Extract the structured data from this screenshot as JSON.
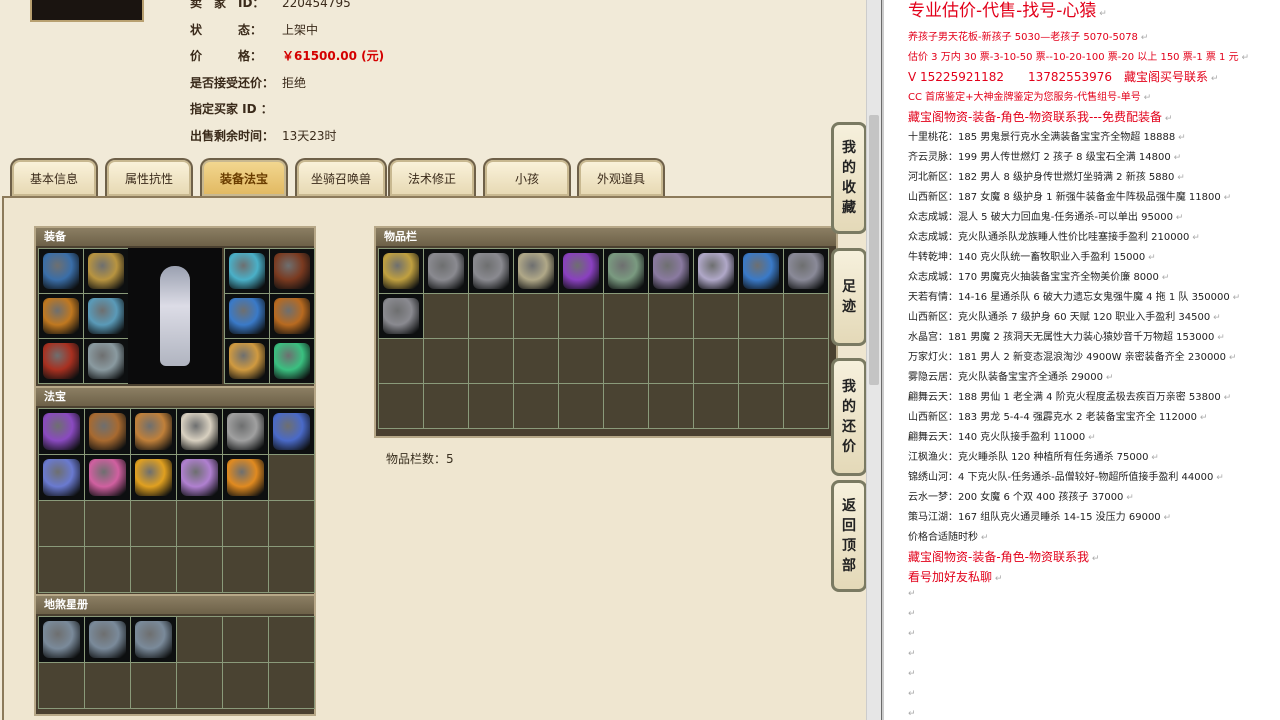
{
  "profile": {
    "rows": [
      {
        "label": "卖　家　ID：",
        "value": "220454795",
        "style": "normal"
      },
      {
        "label": "状　　　态：",
        "value": "上架中",
        "style": "normal"
      },
      {
        "label": "价　　　格：",
        "value": "￥61500.00 (元)",
        "style": "price"
      },
      {
        "label": "是否接受还价：",
        "value": "拒绝",
        "style": "normal"
      },
      {
        "label": "指定买家 ID ：",
        "value": "",
        "style": "normal"
      },
      {
        "label": "出售剩余时间：",
        "value": "13天23时",
        "style": "normal"
      }
    ]
  },
  "tabs": [
    "基本信息",
    "属性抗性",
    "装备法宝",
    "坐骑召唤兽",
    "法术修正",
    "小孩",
    "外观道具"
  ],
  "active_tab": "装备法宝",
  "sections": {
    "equip": "装备",
    "treasure": "法宝",
    "stars": "地煞星册",
    "inventory": "物品栏"
  },
  "inventory_count": "物品栏数：5",
  "side_buttons": [
    {
      "name": "my-collection",
      "chars": [
        "我",
        "的",
        "收",
        "藏"
      ]
    },
    {
      "name": "footprint",
      "chars": [
        "足",
        "迹"
      ]
    },
    {
      "name": "my-bargain",
      "chars": [
        "我",
        "的",
        "还",
        "价"
      ]
    },
    {
      "name": "back-to-top",
      "chars": [
        "返",
        "回",
        "顶",
        "部"
      ]
    }
  ],
  "notes": [
    {
      "text": "专业估价-代售-找号-心猿",
      "style": "big red"
    },
    {
      "text": "养孩子男天花板-新孩子 5030—老孩子 5070-5078",
      "style": "red"
    },
    {
      "text": "估价 3 万内 30 票-3-10-50 票--10-20-100 票-20 以上 150 票-1 票 1 元",
      "style": "red"
    },
    {
      "text": "V 15225921182　　13782553976　藏宝阁买号联系",
      "style": "med red"
    },
    {
      "text": "CC 首席鉴定+大神金牌鉴定为您服务-代售组号-单号",
      "style": "red"
    },
    {
      "text": "藏宝阁物资-装备-角色-物资联系我---免费配装备",
      "style": "med red"
    },
    {
      "text": "十里桃花：185 男鬼景行克水全满装备宝宝齐全物超 18888",
      "style": ""
    },
    {
      "text": "齐云灵脉：199 男人传世燃灯 2 孩子 8 级宝石全满 14800",
      "style": ""
    },
    {
      "text": "河北新区：182 男人 8 级护身传世燃灯坐骑满 2 新孩 5880",
      "style": ""
    },
    {
      "text": "山西新区：187 女魔 8 级护身 1 新强牛装备金牛阵极品强牛魔 11800",
      "style": ""
    },
    {
      "text": "众志成城：混人 5 破大力回血鬼-任务通杀-可以单出 95000",
      "style": ""
    },
    {
      "text": "众志成城：克火队通杀队龙族睡人性价比哇塞接手盈利 210000",
      "style": ""
    },
    {
      "text": "牛转乾坤：140 克火队统一畜牧职业入手盈利 15000",
      "style": ""
    },
    {
      "text": "众志成城：170 男魔克火抽装备宝宝齐全物美价廉 8000",
      "style": ""
    },
    {
      "text": "天若有情：14-16 星通杀队 6 破大力遗忘女鬼强牛魔 4 拖 1 队 350000",
      "style": ""
    },
    {
      "text": "山西新区：克火队通杀 7 级护身 60 天赋 120 职业入手盈利 34500",
      "style": ""
    },
    {
      "text": "水晶宫：181 男魔 2 孩洞天无属性大力装心猿妙音千万物超 153000",
      "style": ""
    },
    {
      "text": "万家灯火：181 男人 2 新变态混浪淘沙 4900W 亲密装备齐全 230000",
      "style": ""
    },
    {
      "text": "雾隐云居：克火队装备宝宝齐全通杀 29000",
      "style": ""
    },
    {
      "text": "翩舞云天：188 男仙 1 老全满 4 阶克火程度孟极去疾百万亲密 53800",
      "style": ""
    },
    {
      "text": "山西新区：183 男龙 5-4-4 强霹克水 2 老装备宝宝齐全 112000",
      "style": ""
    },
    {
      "text": "翩舞云天：140 克火队接手盈利 11000",
      "style": ""
    },
    {
      "text": "江枫渔火：克火睡杀队 120 种植所有任务通杀 75000",
      "style": ""
    },
    {
      "text": "锦绣山河：4 下克火队-任务通杀-品僧较好-物超所值接手盈利 44000",
      "style": ""
    },
    {
      "text": "云水一梦：200 女魔 6 个双 400 孩孩子 37000",
      "style": ""
    },
    {
      "text": "策马江湖：167 组队克火通灵睡杀 14-15 没压力 69000",
      "style": ""
    },
    {
      "text": "价格合适随时秒",
      "style": ""
    },
    {
      "text": "藏宝阁物资-装备-角色-物资联系我",
      "style": "med red"
    },
    {
      "text": "看号加好友私聊",
      "style": "med red"
    },
    {
      "text": "",
      "style": ""
    },
    {
      "text": "",
      "style": ""
    },
    {
      "text": "",
      "style": ""
    },
    {
      "text": "",
      "style": ""
    },
    {
      "text": "",
      "style": ""
    },
    {
      "text": "",
      "style": ""
    },
    {
      "text": "",
      "style": ""
    }
  ],
  "colors": {
    "red": "#e2001a",
    "price": "#d40000",
    "panel": "#4a4332",
    "item_bg": "#0d0f10"
  },
  "equip_icons": [
    "helmet-icon",
    "weapon-icon",
    "claw-icon",
    "necklace-icon",
    "glove-icon",
    "boots-icon"
  ],
  "equip_right_icons": [
    "hat-icon",
    "armor-icon",
    "ring-icon",
    "belt-icon",
    "bracer-icon",
    "orb-icon"
  ],
  "treasure_icons": [
    "lantern-icon",
    "bell-icon",
    "sword-icon",
    "scroll-icon",
    "chain-icon",
    "fan-icon",
    "book-icon",
    "lamp-icon",
    "flame-icon",
    "pipe-icon",
    "beast-icon"
  ],
  "star_icons": [
    "warrior-card-icon",
    "warrior-card-icon",
    "warrior-card-icon"
  ],
  "inventory_icons": [
    "figure-icon",
    "rock-icon",
    "rock-icon",
    "shell-icon",
    "pendant-icon",
    "feather-icon",
    "mask-icon",
    "cloth-icon",
    "ring-icon",
    "dagger-icon",
    "rock-icon"
  ]
}
